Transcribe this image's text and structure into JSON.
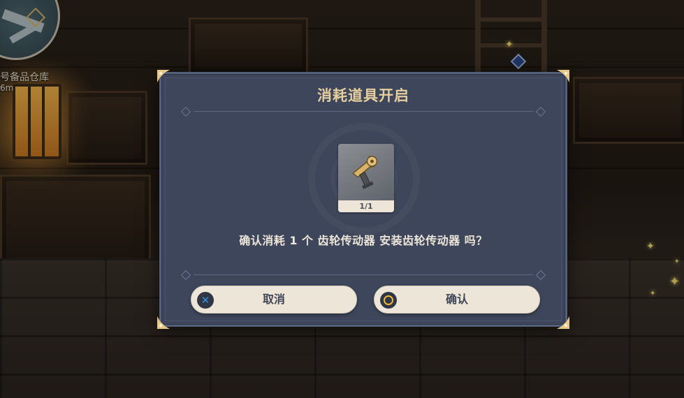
{
  "hud": {
    "location_name": "号备品仓库",
    "distance": "6m"
  },
  "dialog": {
    "title": "消耗道具开启",
    "item": {
      "name": "齿轮传动器",
      "icon": "gear-transmission-icon",
      "count": "1/1"
    },
    "prompt": "确认消耗 1 个 齿轮传动器 安装齿轮传动器 吗？",
    "cancel_button": {
      "label": "取消",
      "glyph": "✕",
      "glyph_color": "#3a8ee8"
    },
    "confirm_button": {
      "label": "确认",
      "glyph": "○",
      "glyph_color": "#f2b633"
    }
  },
  "colors": {
    "dialog_background": "#3e465b",
    "title_gold": "#e6cf9c",
    "button_background": "#ece5d8"
  }
}
